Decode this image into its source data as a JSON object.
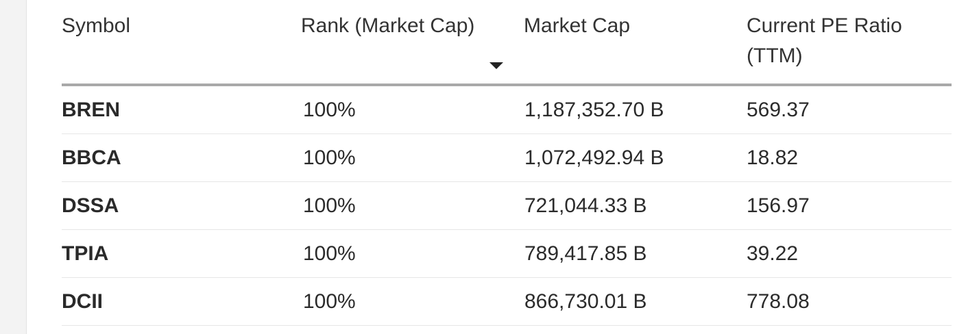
{
  "columns": {
    "symbol": "Symbol",
    "rank": "Rank (Market Cap)",
    "market_cap": "Market Cap",
    "pe_ratio": "Current PE Ratio (TTM)"
  },
  "sort": {
    "icon": "caret-down-icon",
    "column": "rank"
  },
  "rows": [
    {
      "symbol": "BREN",
      "rank": "100%",
      "market_cap": "1,187,352.70 B",
      "pe_ratio": "569.37"
    },
    {
      "symbol": "BBCA",
      "rank": "100%",
      "market_cap": "1,072,492.94 B",
      "pe_ratio": "18.82"
    },
    {
      "symbol": "DSSA",
      "rank": "100%",
      "market_cap": "721,044.33 B",
      "pe_ratio": "156.97"
    },
    {
      "symbol": "TPIA",
      "rank": "100%",
      "market_cap": "789,417.85 B",
      "pe_ratio": "39.22"
    },
    {
      "symbol": "DCII",
      "rank": "100%",
      "market_cap": "866,730.01 B",
      "pe_ratio": "778.08"
    }
  ]
}
